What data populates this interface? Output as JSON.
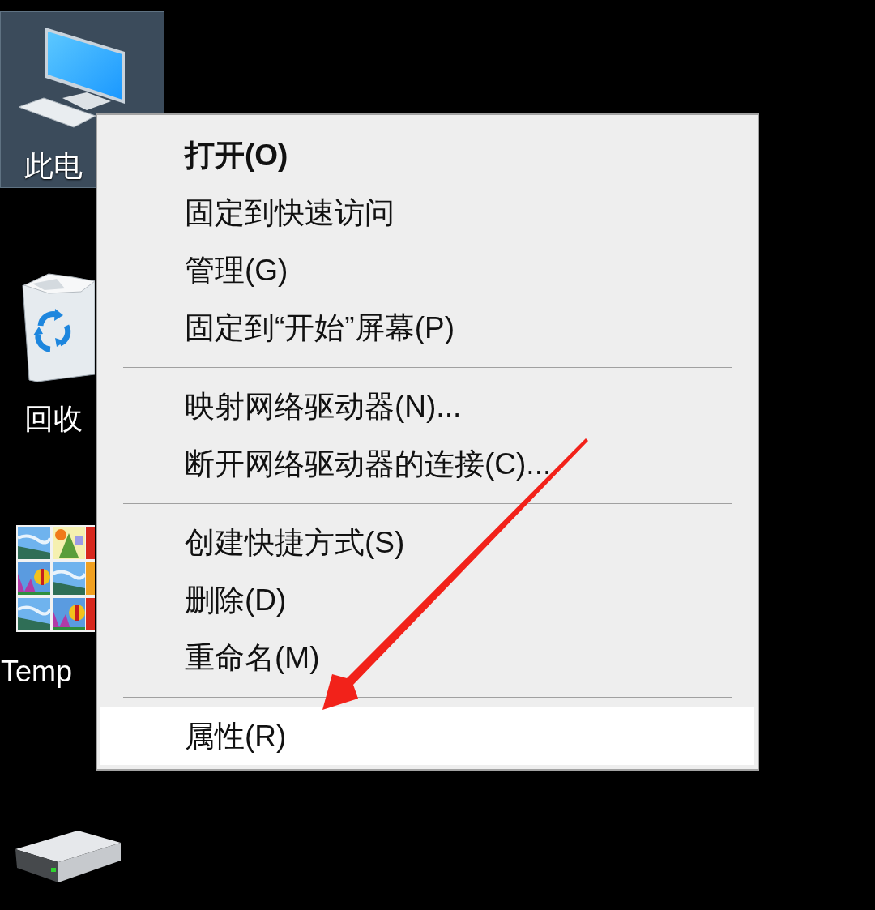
{
  "desktop": {
    "icons": [
      {
        "kind": "computer",
        "label": "此电",
        "selected": true
      },
      {
        "kind": "recycle-bin",
        "label": "回收",
        "selected": false
      },
      {
        "kind": "photos",
        "label": "Temp",
        "selected": false
      },
      {
        "kind": "drive",
        "selected": false
      }
    ]
  },
  "context_menu": {
    "items": [
      {
        "kind": "item",
        "label": "打开(O)",
        "default": true,
        "selected": false
      },
      {
        "kind": "item",
        "label": "固定到快速访问",
        "default": false,
        "selected": false
      },
      {
        "kind": "item",
        "label": "管理(G)",
        "default": false,
        "selected": false
      },
      {
        "kind": "item",
        "label": "固定到“开始”屏幕(P)",
        "default": false,
        "selected": false
      },
      {
        "kind": "separator"
      },
      {
        "kind": "item",
        "label": "映射网络驱动器(N)...",
        "default": false,
        "selected": false
      },
      {
        "kind": "item",
        "label": "断开网络驱动器的连接(C)...",
        "default": false,
        "selected": false
      },
      {
        "kind": "separator"
      },
      {
        "kind": "item",
        "label": "创建快捷方式(S)",
        "default": false,
        "selected": false
      },
      {
        "kind": "item",
        "label": "删除(D)",
        "default": false,
        "selected": false
      },
      {
        "kind": "item",
        "label": "重命名(M)",
        "default": false,
        "selected": false
      },
      {
        "kind": "separator"
      },
      {
        "kind": "item",
        "label": "属性(R)",
        "default": false,
        "selected": true
      }
    ]
  }
}
